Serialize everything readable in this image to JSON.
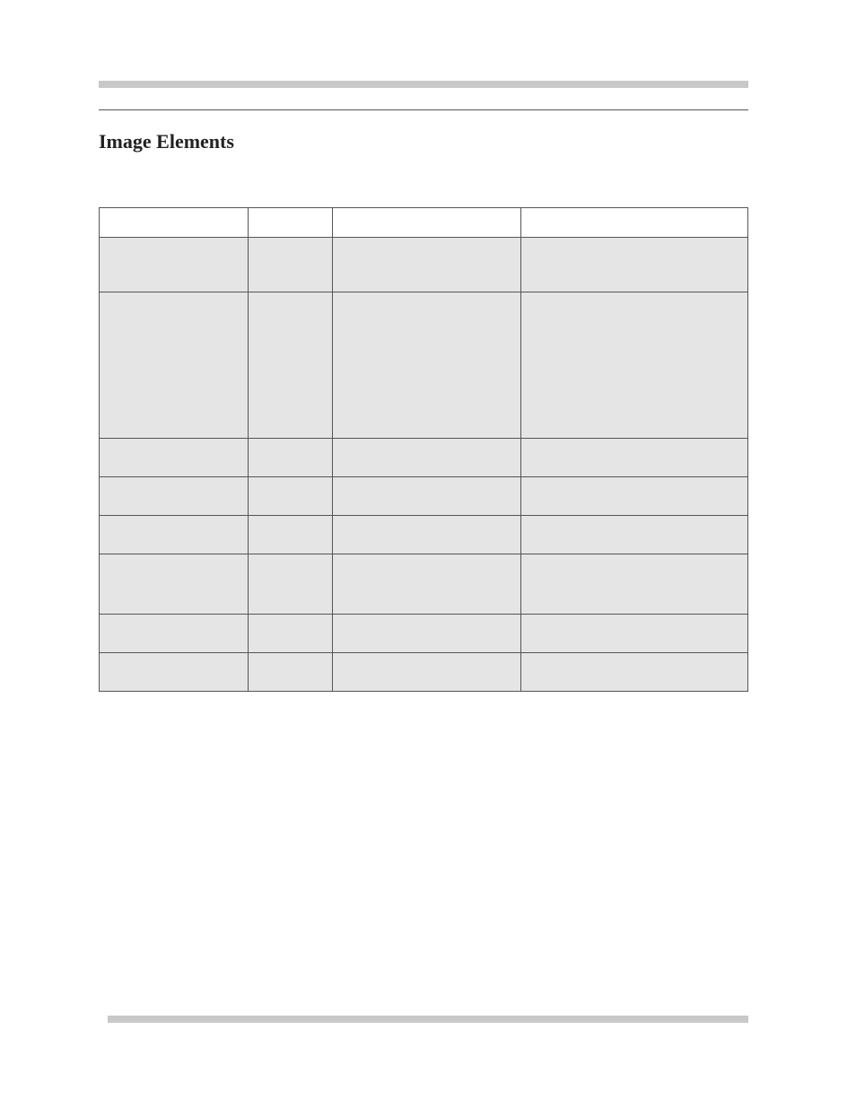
{
  "section_heading": "Image Elements",
  "table": {
    "headers": [
      "",
      "",
      "",
      ""
    ],
    "rows": [
      {
        "size": "h-small",
        "cells": [
          "",
          "",
          "",
          ""
        ]
      },
      {
        "size": "h-large",
        "cells": [
          "",
          "",
          "",
          ""
        ]
      },
      {
        "size": "h-short",
        "cells": [
          "",
          "",
          "",
          ""
        ]
      },
      {
        "size": "h-short",
        "cells": [
          "",
          "",
          "",
          ""
        ]
      },
      {
        "size": "h-short",
        "cells": [
          "",
          "",
          "",
          ""
        ]
      },
      {
        "size": "h-med",
        "cells": [
          "",
          "",
          "",
          ""
        ]
      },
      {
        "size": "h-short",
        "cells": [
          "",
          "",
          "",
          ""
        ]
      },
      {
        "size": "h-short",
        "cells": [
          "",
          "",
          "",
          ""
        ]
      }
    ]
  }
}
